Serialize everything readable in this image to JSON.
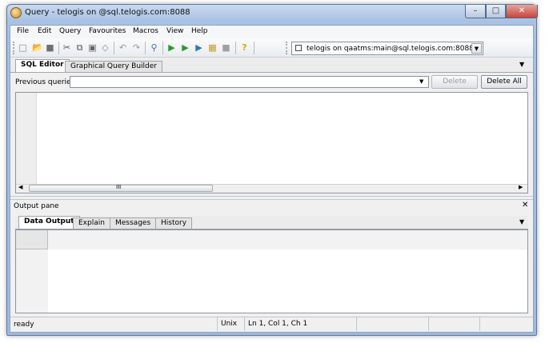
{
  "window": {
    "title": "Query - telogis on @sql.telogis.com:8088",
    "controls": {
      "minimize": "–",
      "maximize": "□",
      "close": "✕"
    }
  },
  "menu": {
    "items": [
      "File",
      "Edit",
      "Query",
      "Favourites",
      "Macros",
      "View",
      "Help"
    ]
  },
  "toolbar": {
    "icons": [
      "new-file-icon",
      "open-folder-icon",
      "save-icon",
      "cut-icon",
      "copy-icon",
      "paste-icon",
      "clear-icon",
      "undo-icon",
      "redo-icon",
      "find-icon",
      "execute-icon",
      "execute-to-file-icon",
      "explain-icon",
      "explain-analyze-icon",
      "stop-icon",
      "help-icon"
    ],
    "connection": "telogis on qaatms:main@sql.telogis.com:8088"
  },
  "editor_tabs": [
    "SQL Editor",
    "Graphical Query Builder"
  ],
  "previous_queries": {
    "label": "Previous queries",
    "delete": "Delete",
    "delete_all": "Delete All"
  },
  "scroll_grip": "III",
  "output": {
    "pane_title": "Output pane",
    "tabs": [
      "Data Output",
      "Explain",
      "Messages",
      "History"
    ]
  },
  "status": {
    "state": "ready",
    "line_endings": "Unix",
    "position": "Ln 1, Col 1, Ch 1"
  },
  "colors": {
    "title_gradient_top": "#c9daf0",
    "close_button": "#c7443a",
    "chrome": "#f0f0f0"
  }
}
